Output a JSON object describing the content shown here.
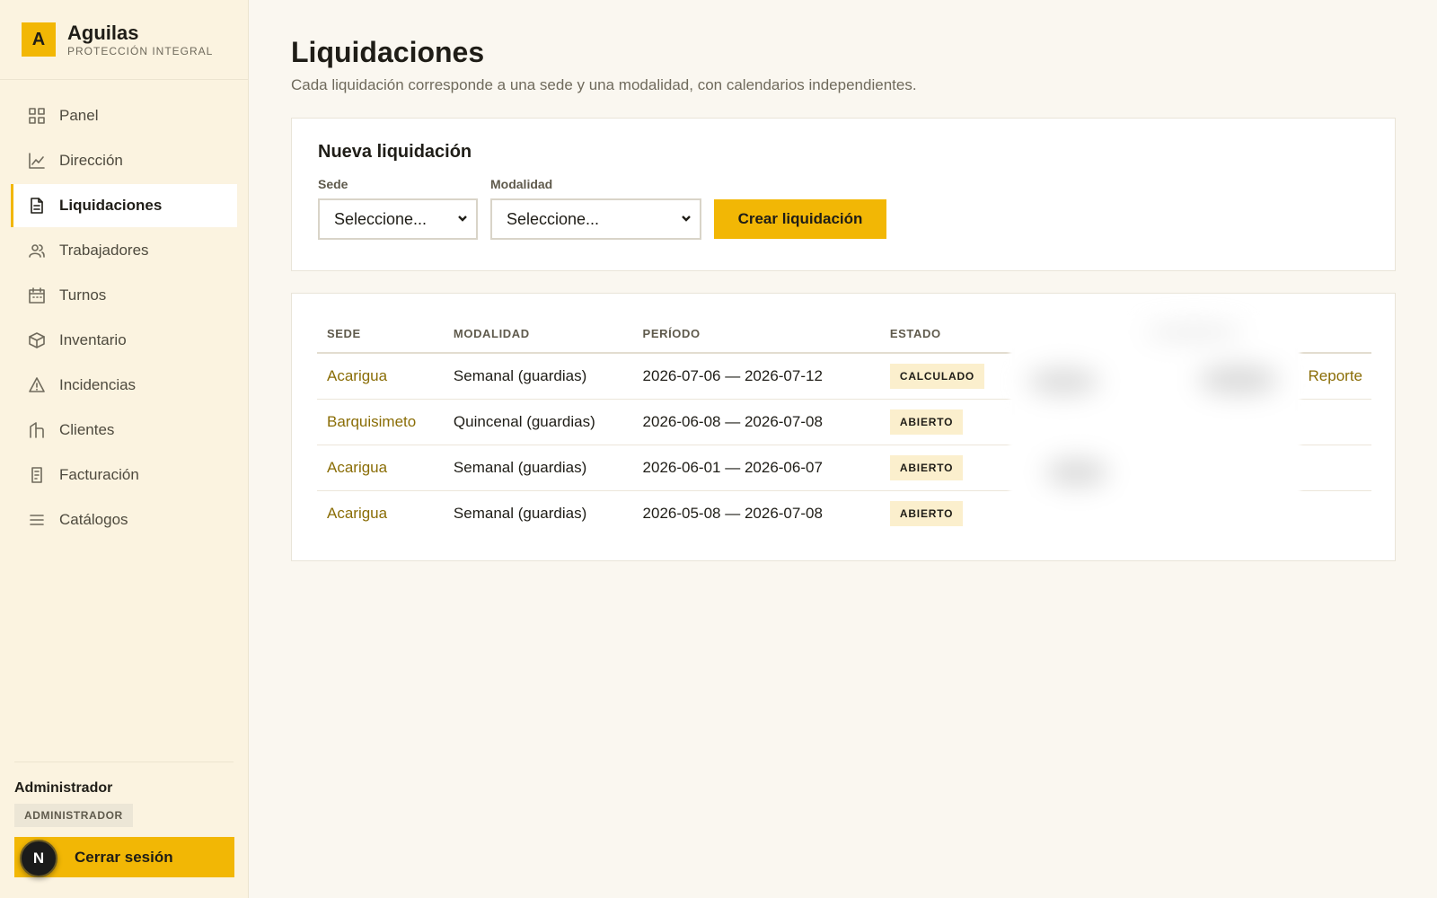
{
  "brand": {
    "logo_letter": "A",
    "name": "Aguilas",
    "subtitle": "PROTECCIÓN INTEGRAL"
  },
  "sidebar": {
    "items": [
      {
        "label": "Panel",
        "icon": "grid-icon",
        "active": false
      },
      {
        "label": "Dirección",
        "icon": "line-chart-icon",
        "active": false
      },
      {
        "label": "Liquidaciones",
        "icon": "document-icon",
        "active": true
      },
      {
        "label": "Trabajadores",
        "icon": "users-icon",
        "active": false
      },
      {
        "label": "Turnos",
        "icon": "calendar-icon",
        "active": false
      },
      {
        "label": "Inventario",
        "icon": "box-icon",
        "active": false
      },
      {
        "label": "Incidencias",
        "icon": "warning-icon",
        "active": false
      },
      {
        "label": "Clientes",
        "icon": "building-icon",
        "active": false
      },
      {
        "label": "Facturación",
        "icon": "receipt-icon",
        "active": false
      },
      {
        "label": "Catálogos",
        "icon": "list-icon",
        "active": false
      }
    ],
    "user": {
      "name": "Administrador",
      "role": "ADMINISTRADOR",
      "avatar_letter": "N",
      "logout_label": "Cerrar sesión"
    }
  },
  "page": {
    "title": "Liquidaciones",
    "subtitle": "Cada liquidación corresponde a una sede y una modalidad, con calendarios independientes."
  },
  "create_form": {
    "title": "Nueva liquidación",
    "sede_label": "Sede",
    "sede_value": "Seleccione...",
    "modalidad_label": "Modalidad",
    "modalidad_value": "Seleccione...",
    "submit_label": "Crear liquidación"
  },
  "table": {
    "headers": [
      "SEDE",
      "MODALIDAD",
      "PERÍODO",
      "ESTADO"
    ],
    "rows": [
      {
        "sede": "Acarigua",
        "modalidad": "Semanal (guardias)",
        "periodo": "2026-07-06 — 2026-07-12",
        "estado": "CALCULADO",
        "action": "Reporte"
      },
      {
        "sede": "Barquisimeto",
        "modalidad": "Quincenal (guardias)",
        "periodo": "2026-06-08 — 2026-07-08",
        "estado": "ABIERTO",
        "action": ""
      },
      {
        "sede": "Acarigua",
        "modalidad": "Semanal (guardias)",
        "periodo": "2026-06-01 — 2026-06-07",
        "estado": "ABIERTO",
        "action": ""
      },
      {
        "sede": "Acarigua",
        "modalidad": "Semanal (guardias)",
        "periodo": "2026-05-08 — 2026-07-08",
        "estado": "ABIERTO",
        "action": ""
      }
    ]
  },
  "colors": {
    "accent": "#f2b705",
    "sidebar_bg": "#fbf3e0",
    "link": "#8a6d06",
    "status_bg": "#fbefcd"
  }
}
